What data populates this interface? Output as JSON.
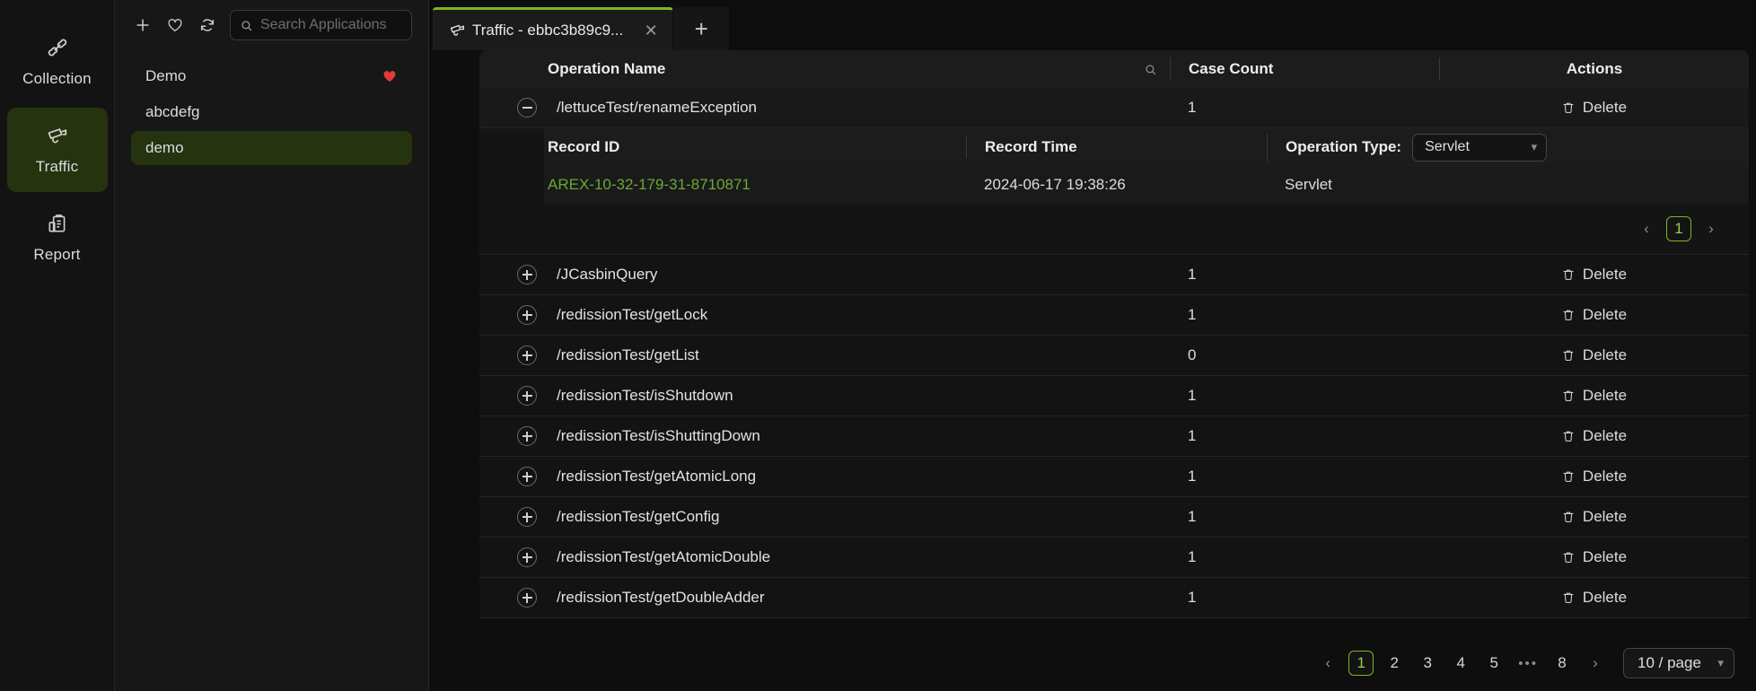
{
  "rail": {
    "items": [
      {
        "label": "Collection",
        "icon": "api-link-icon",
        "active": false
      },
      {
        "label": "Traffic",
        "icon": "cctv-camera-icon",
        "active": true
      },
      {
        "label": "Report",
        "icon": "clipboard-report-icon",
        "active": false
      }
    ]
  },
  "applist": {
    "toolbar": {
      "add_icon": "plus-icon",
      "favorite_icon": "heart-outline-icon",
      "refresh_icon": "refresh-icon",
      "search_icon": "search-icon",
      "search_value": "",
      "search_placeholder": "Search Applications"
    },
    "items": [
      {
        "label": "Demo",
        "favorite": true,
        "selected": false
      },
      {
        "label": "abcdefg",
        "favorite": false,
        "selected": false
      },
      {
        "label": "demo",
        "favorite": false,
        "selected": true
      }
    ]
  },
  "tabs": {
    "items": [
      {
        "title": "Traffic - ebbc3b89c9...",
        "icon": "cctv-camera-icon",
        "active": true,
        "close_icon": "close-icon"
      }
    ],
    "add_label": "+"
  },
  "table": {
    "headers": {
      "operation_name": "Operation Name",
      "case_count": "Case Count",
      "actions": "Actions",
      "search_icon": "search-icon"
    },
    "delete_label": "Delete",
    "rows": [
      {
        "name": "/lettuceTest/renameException",
        "count": "1",
        "expanded": true
      },
      {
        "name": "/JCasbinQuery",
        "count": "1",
        "expanded": false
      },
      {
        "name": "/redissionTest/getLock",
        "count": "1",
        "expanded": false
      },
      {
        "name": "/redissionTest/getList",
        "count": "0",
        "expanded": false
      },
      {
        "name": "/redissionTest/isShutdown",
        "count": "1",
        "expanded": false
      },
      {
        "name": "/redissionTest/isShuttingDown",
        "count": "1",
        "expanded": false
      },
      {
        "name": "/redissionTest/getAtomicLong",
        "count": "1",
        "expanded": false
      },
      {
        "name": "/redissionTest/getConfig",
        "count": "1",
        "expanded": false
      },
      {
        "name": "/redissionTest/getAtomicDouble",
        "count": "1",
        "expanded": false
      },
      {
        "name": "/redissionTest/getDoubleAdder",
        "count": "1",
        "expanded": false
      }
    ]
  },
  "detail": {
    "headers": {
      "record_id": "Record ID",
      "record_time": "Record Time",
      "operation_type": "Operation Type:"
    },
    "operation_type_value": "Servlet",
    "records": [
      {
        "id": "AREX-10-32-179-31-8710871",
        "time": "2024-06-17 19:38:26",
        "type": "Servlet"
      }
    ],
    "pager": {
      "prev": "‹",
      "next": "›",
      "current": "1"
    }
  },
  "footer_pager": {
    "prev": "‹",
    "next": "›",
    "pages": [
      "1",
      "2",
      "3",
      "4",
      "5"
    ],
    "ellipsis": "•••",
    "last": "8",
    "current": "1",
    "page_size": "10 / page"
  },
  "colors": {
    "accent_green": "#7bb724",
    "link_green": "#6ba832",
    "favorite_red": "#e03b36",
    "panel_bg": "#171717",
    "main_bg": "#0e0e0e"
  }
}
